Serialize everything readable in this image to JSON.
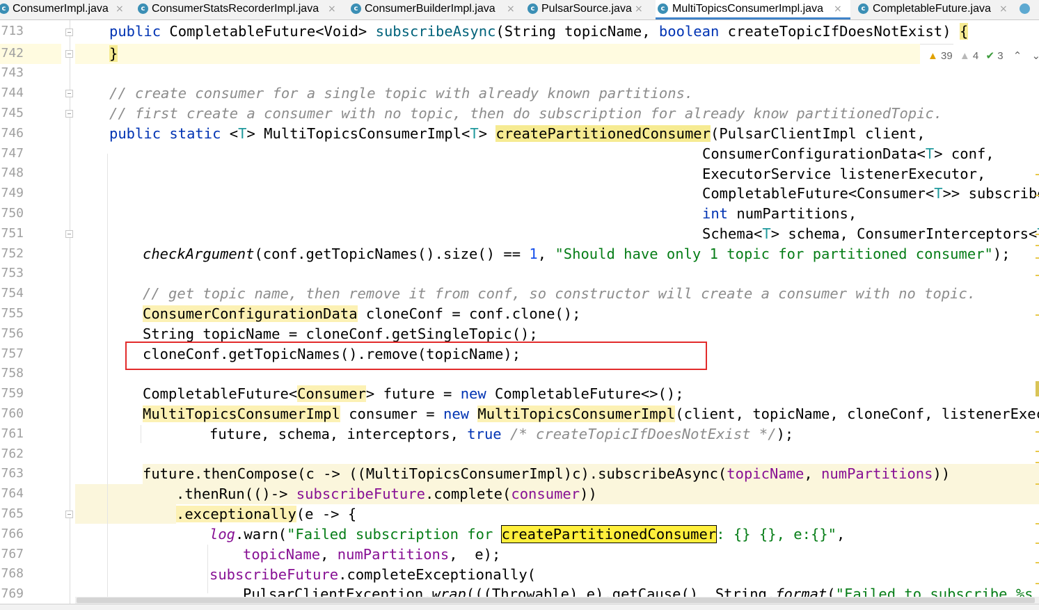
{
  "tabs": [
    {
      "label": "ConsumerImpl.java",
      "close": "×"
    },
    {
      "label": "ConsumerStatsRecorderImpl.java",
      "close": "×"
    },
    {
      "label": "ConsumerBuilderImpl.java",
      "close": "×"
    },
    {
      "label": "PulsarSource.java",
      "close": "×"
    },
    {
      "label": "MultiTopicsConsumerImpl.java",
      "close": "×",
      "active": true
    },
    {
      "label": "CompletableFuture.java",
      "close": "×"
    }
  ],
  "tab_icon_letter": "c",
  "inspections": {
    "warnings": "39",
    "weak_warnings": "4",
    "typos": "3"
  },
  "line_numbers": [
    "713",
    "742",
    "743",
    "744",
    "745",
    "746",
    "747",
    "748",
    "749",
    "750",
    "751",
    "752",
    "753",
    "754",
    "755",
    "756",
    "757",
    "758",
    "759",
    "760",
    "761",
    "762",
    "763",
    "764",
    "765",
    "766",
    "767",
    "768",
    "769"
  ],
  "code": {
    "l713": {
      "a": "public",
      "b": " CompletableFuture<Void> ",
      "c": "subscribeAsync",
      "d": "(String topicName, ",
      "e": "boolean",
      "f": " createTopicIfDoesNotExist) ",
      "g": "{"
    },
    "l742": {
      "a": "}"
    },
    "l744": "// create consumer for a single topic with already known partitions.",
    "l745": "// first create a consumer with no topic, then do subscription for already know partitionedTopic.",
    "l746": {
      "a": "public static",
      "b": " <",
      "c": "T",
      "d": "> MultiTopicsConsumerImpl<",
      "e": "T",
      "f": "> ",
      "g": "createPartitionedConsumer",
      "h": "(PulsarClientImpl client,"
    },
    "l747": {
      "a": "ConsumerConfigurationData<",
      "b": "T",
      "c": "> conf,"
    },
    "l748": "ExecutorService listenerExecutor,",
    "l749": {
      "a": "CompletableFuture<Consumer<",
      "b": "T",
      "c": ">> subscribeF"
    },
    "l750": {
      "a": "int",
      "b": " numPartitions,"
    },
    "l751": {
      "a": "Schema<",
      "b": "T",
      "c": "> schema, ConsumerInterceptors<",
      "d": "T",
      "e": ">"
    },
    "l752": {
      "a": "checkArgument",
      "b": "(conf.getTopicNames().size() == ",
      "c": "1",
      "d": ", ",
      "e": "\"Should have only 1 topic for partitioned consumer\"",
      "f": ");"
    },
    "l754": "// get topic name, then remove it from conf, so constructor will create a consumer with no topic.",
    "l755": {
      "a": "ConsumerConfigurationData",
      "b": " cloneConf = conf.clone();"
    },
    "l756": "String topicName = cloneConf.getSingleTopic();",
    "l757": "cloneConf.getTopicNames().remove(topicName);",
    "l759": {
      "a": "CompletableFuture<",
      "b": "Consumer",
      "c": "> future = ",
      "d": "new",
      "e": " CompletableFuture<>();"
    },
    "l760": {
      "a": "MultiTopicsConsumerImpl",
      "b": " consumer = ",
      "c": "new",
      "d": " ",
      "e": "MultiTopicsConsumerImpl",
      "f": "(client, topicName, cloneConf, listenerExecuto"
    },
    "l761": {
      "a": "future, schema, interceptors, ",
      "b": "true",
      "c": " ",
      "d": "/* createTopicIfDoesNotExist */",
      "e": ");"
    },
    "l763": {
      "a": "future.thenCompose(c -> ((MultiTopicsConsumerImpl)c).subscribeAsync(",
      "b": "topicName",
      "c": ", ",
      "d": "numPartitions",
      "e": "))"
    },
    "l764": {
      "a": ".thenRun(()-> ",
      "b": "subscribeFuture",
      "c": ".complete(",
      "d": "consumer",
      "e": "))"
    },
    "l765": {
      "a": ".exceptionally",
      "b": "(e -> {"
    },
    "l766": {
      "a": "log",
      "b": ".warn(",
      "c": "\"Failed subscription for ",
      "d": "createPartitionedConsumer",
      "e": ": {} {}, e:{}\"",
      "f": ","
    },
    "l767": {
      "a": "topicName",
      "b": ", ",
      "c": "numPartitions",
      "d": ",  e);"
    },
    "l768": {
      "a": "subscribeFuture",
      "b": ".completeExceptionally("
    },
    "l769": {
      "a": "PulsarClientException.",
      "b": "wrap",
      "c": "(((Throwable) e).getCause(), String.",
      "d": "format",
      "e": "(",
      "f": "\"Failed to subscribe %s wi"
    }
  },
  "colors": {
    "keyword": "#0033b3",
    "comment": "#8c8c8c",
    "string": "#067d17",
    "field": "#871094",
    "highlight": "#fcf1b4",
    "annotation_box": "#e22b2b",
    "active_tab": "#4083c9"
  }
}
